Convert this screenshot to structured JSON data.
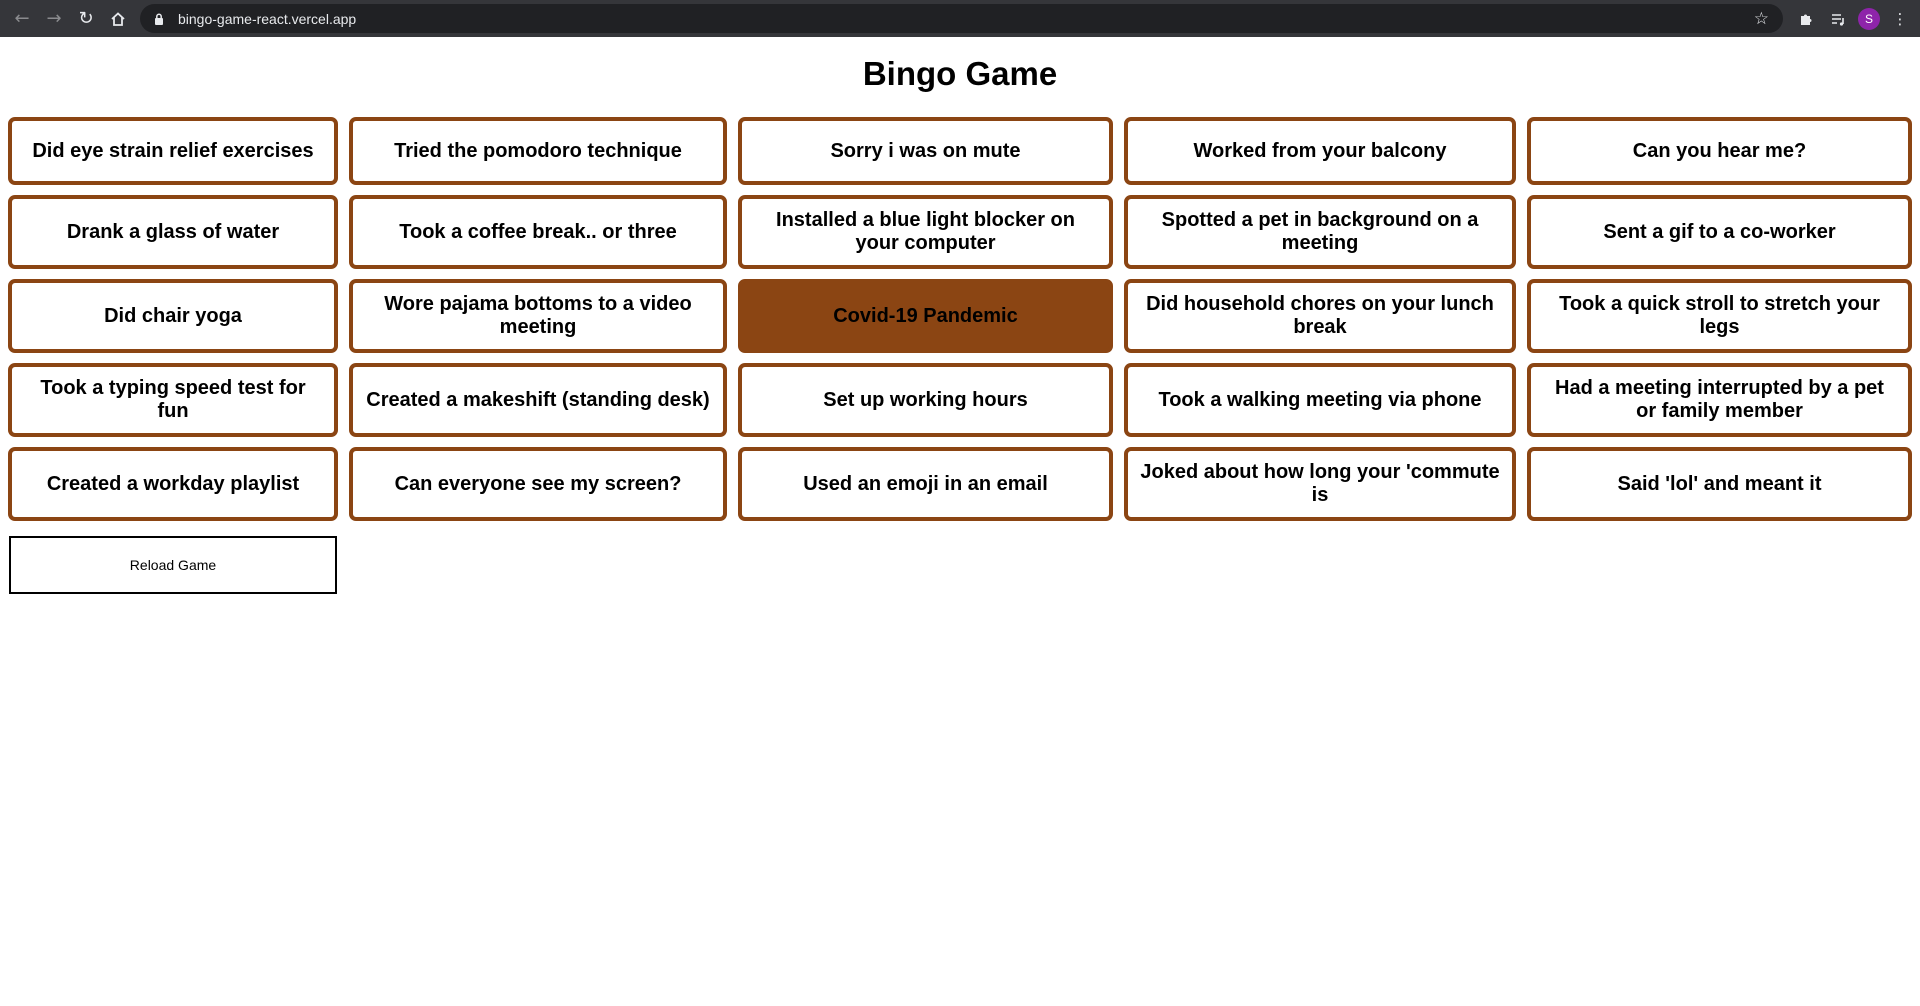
{
  "browser": {
    "url": "bingo-game-react.vercel.app",
    "profile_initial": "S",
    "profile_color": "#8e24aa"
  },
  "page": {
    "title": "Bingo Game",
    "reload_label": "Reload Game",
    "accent_color": "#8b4513"
  },
  "board": {
    "rows": [
      [
        {
          "label": "Did eye strain relief exercises",
          "marked": false
        },
        {
          "label": "Tried the pomodoro technique",
          "marked": false
        },
        {
          "label": "Sorry i was on mute",
          "marked": false
        },
        {
          "label": "Worked from your balcony",
          "marked": false
        },
        {
          "label": "Can you hear me?",
          "marked": false
        }
      ],
      [
        {
          "label": "Drank a glass of water",
          "marked": false
        },
        {
          "label": "Took a coffee break.. or three",
          "marked": false
        },
        {
          "label": "Installed a blue light blocker on your computer",
          "marked": false
        },
        {
          "label": "Spotted a pet in background on a meeting",
          "marked": false
        },
        {
          "label": "Sent a gif to a co-worker",
          "marked": false
        }
      ],
      [
        {
          "label": "Did chair yoga",
          "marked": false
        },
        {
          "label": "Wore pajama bottoms to a video meeting",
          "marked": false
        },
        {
          "label": "Covid-19 Pandemic",
          "marked": true
        },
        {
          "label": "Did household chores on your lunch break",
          "marked": false
        },
        {
          "label": "Took a quick stroll to stretch your legs",
          "marked": false
        }
      ],
      [
        {
          "label": "Took a typing speed test for fun",
          "marked": false
        },
        {
          "label": "Created a makeshift (standing desk)",
          "marked": false
        },
        {
          "label": "Set up working hours",
          "marked": false
        },
        {
          "label": "Took a walking meeting via phone",
          "marked": false
        },
        {
          "label": "Had a meeting interrupted by a pet or family member",
          "marked": false
        }
      ],
      [
        {
          "label": "Created a workday playlist",
          "marked": false
        },
        {
          "label": "Can everyone see my screen?",
          "marked": false
        },
        {
          "label": "Used an emoji in an email",
          "marked": false
        },
        {
          "label": "Joked about how long your 'commute is",
          "marked": false
        },
        {
          "label": "Said 'lol' and meant it",
          "marked": false
        }
      ]
    ]
  }
}
